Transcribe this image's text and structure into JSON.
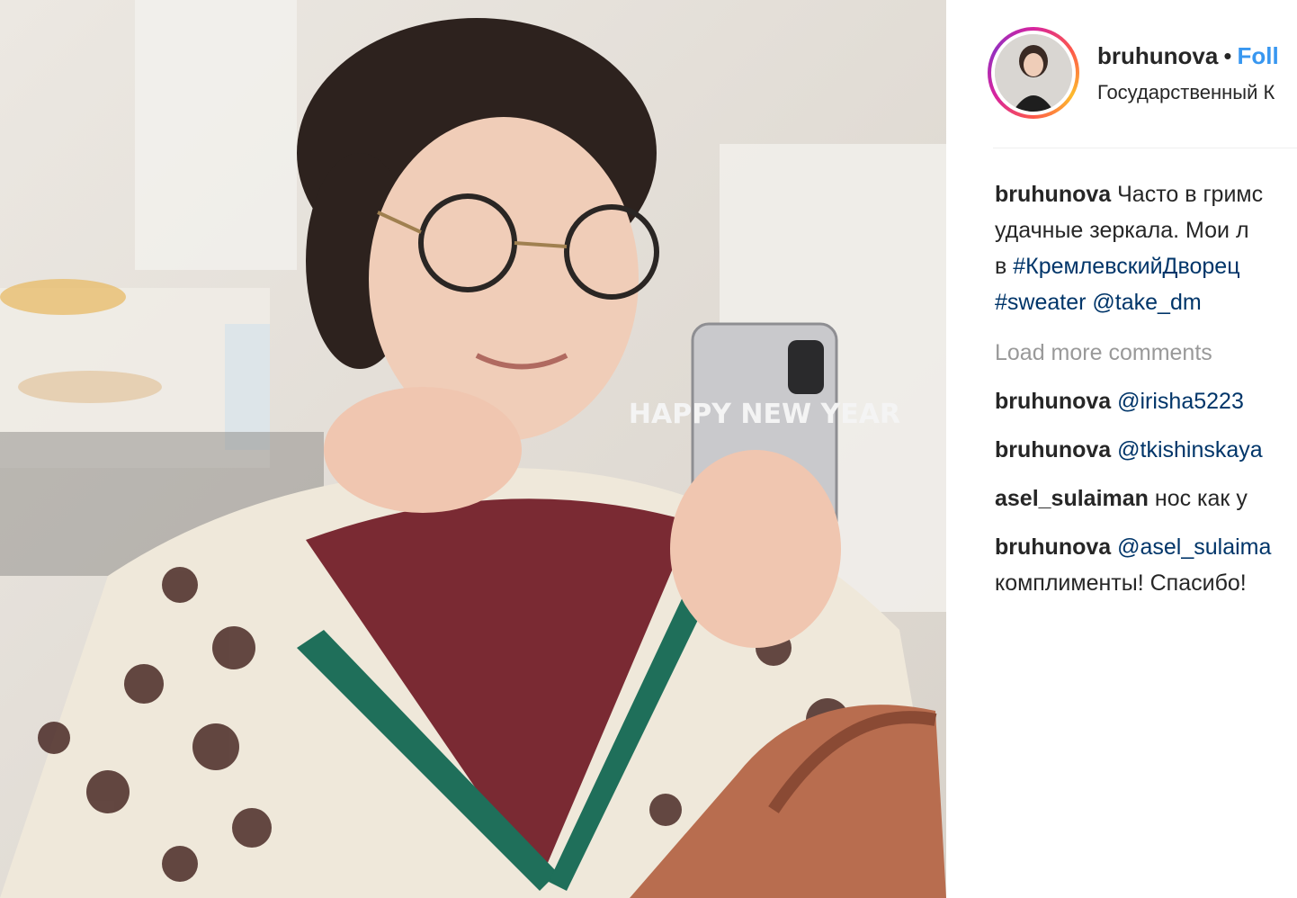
{
  "post": {
    "username": "bruhunova",
    "separator": "•",
    "follow_label": "Foll",
    "location": "Государственный К"
  },
  "caption": {
    "username": "bruhunova",
    "line1": "Часто в гримс",
    "line2": "удачные зеркала. Мои л",
    "line3_prefix": "в",
    "line3_tag": "#КремлевскийДворец",
    "line4_tag": "#sweater",
    "line4_mention": "@take_dm"
  },
  "load_more_label": "Load more comments",
  "comments": [
    {
      "user": "bruhunova",
      "mention": "@irisha5223",
      "text": ""
    },
    {
      "user": "bruhunova",
      "mention": "@tkishinskaya",
      "text": ""
    },
    {
      "user": "asel_sulaiman",
      "mention": "",
      "text": "нос как у"
    },
    {
      "user": "bruhunova",
      "mention": "@asel_sulaima",
      "text": "",
      "line2": "комплименты! Спасибо!"
    }
  ],
  "photo": {
    "phone_case_text": "HAPPY NEW YEAR"
  },
  "colors": {
    "link": "#003569",
    "follow": "#3897f0",
    "muted": "#999999",
    "text": "#262626"
  }
}
